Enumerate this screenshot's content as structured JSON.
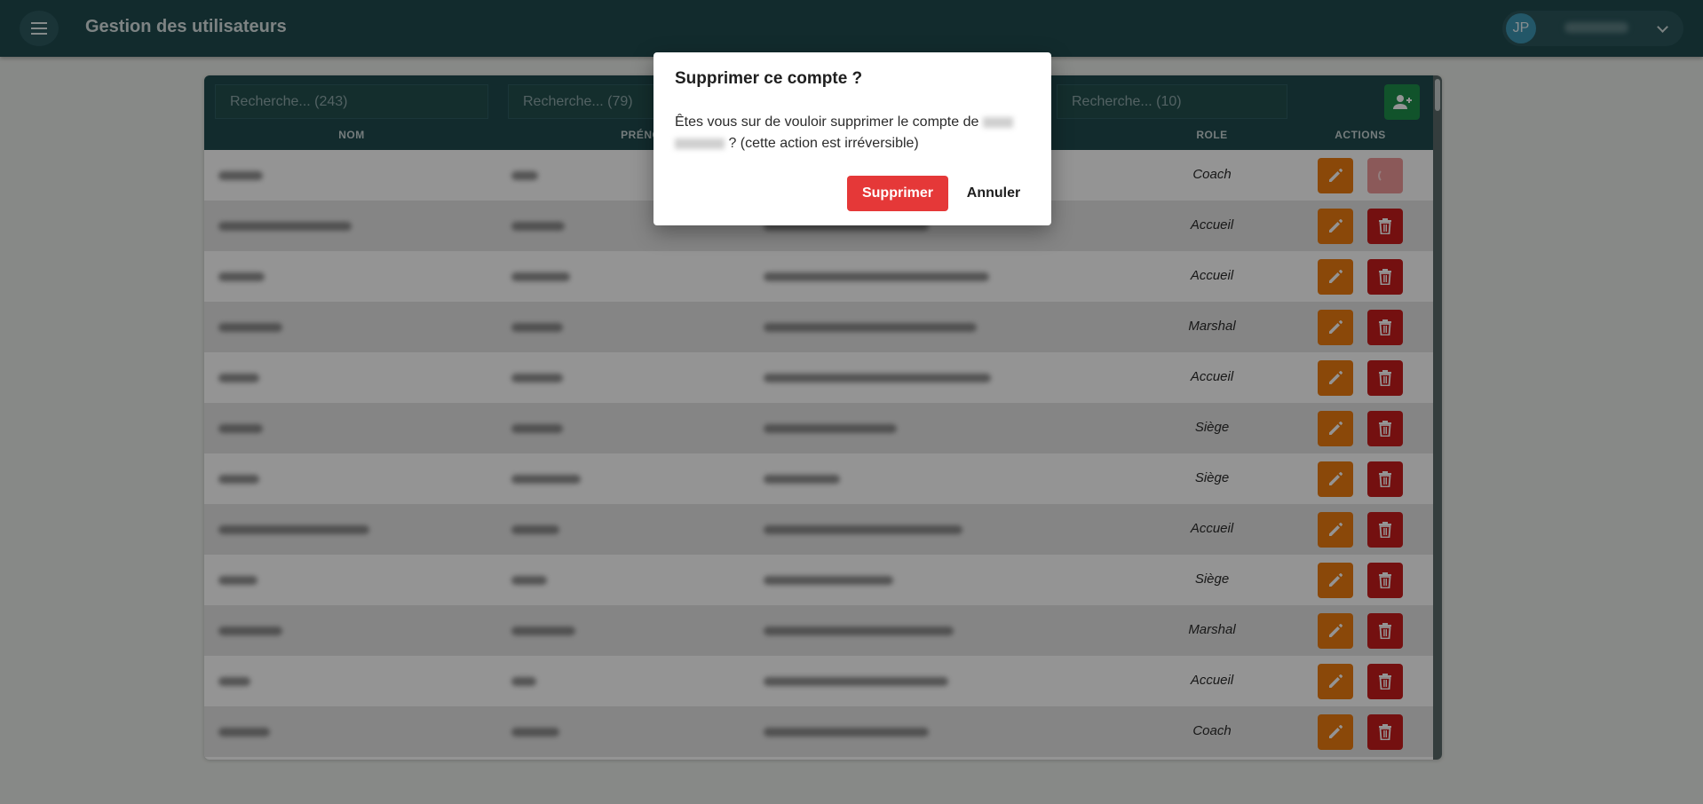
{
  "header": {
    "title": "Gestion des utilisateurs",
    "avatar_initials": "JP",
    "menu_icon": "hamburger-icon",
    "user_menu_icon": "chevron-down-icon"
  },
  "table": {
    "filters": [
      {
        "placeholder": "Recherche... (243)"
      },
      {
        "placeholder": "Recherche... (79)"
      },
      {
        "placeholder": "Recherche... (10)"
      }
    ],
    "columns": [
      "NOM",
      "PRÉNOM",
      "ROLE",
      "ACTIONS"
    ],
    "add_icon": "add-user-icon",
    "rows": [
      {
        "role": "Coach",
        "delete_state": "loading"
      },
      {
        "role": "Accueil"
      },
      {
        "role": "Accueil"
      },
      {
        "role": "Marshal"
      },
      {
        "role": "Accueil"
      },
      {
        "role": "Siège"
      },
      {
        "role": "Siège"
      },
      {
        "role": "Accueil"
      },
      {
        "role": "Siège"
      },
      {
        "role": "Marshal"
      },
      {
        "role": "Accueil"
      },
      {
        "role": "Coach"
      }
    ]
  },
  "dialog": {
    "title": "Supprimer ce compte ?",
    "message_prefix": "Êtes vous sur de vouloir supprimer le compte de",
    "message_suffix": "? (cette action est irréversible)",
    "confirm_label": "Supprimer",
    "cancel_label": "Annuler"
  },
  "colors": {
    "primary": "#1f4a4f",
    "edit": "#ee7d11",
    "delete": "#c81d1d",
    "add": "#1e8f4a",
    "confirm": "#e53838"
  }
}
